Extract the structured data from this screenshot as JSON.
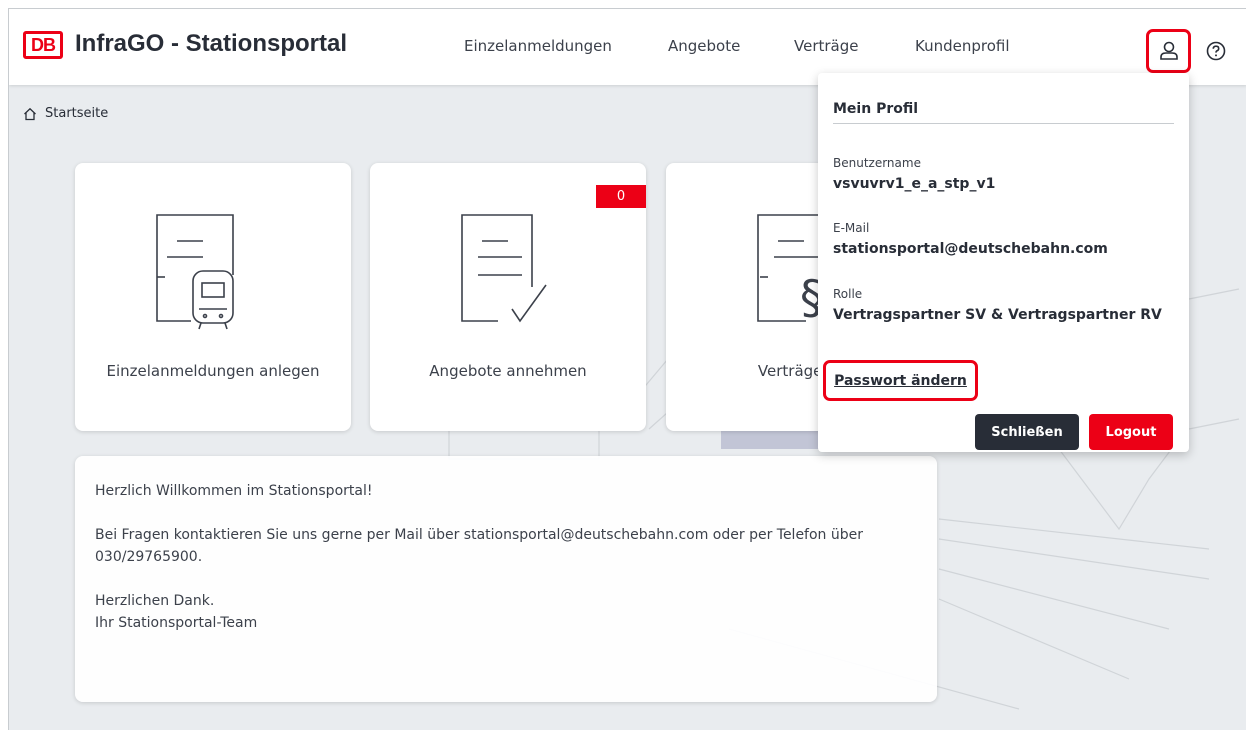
{
  "header": {
    "logo": "DB",
    "title": "InfraGO - Stationsportal",
    "nav": [
      "Einzelanmeldungen",
      "Angebote",
      "Verträge",
      "Kundenprofil"
    ],
    "icons": [
      "user-icon",
      "help-icon"
    ]
  },
  "breadcrumb": {
    "label": "Startseite"
  },
  "tiles": [
    {
      "label": "Einzelanmeldungen anlegen"
    },
    {
      "label": "Angebote annehmen",
      "badge": "0"
    },
    {
      "label": "Verträge ein"
    }
  ],
  "welcome": {
    "line1": "Herzlich Willkommen im Stationsportal!",
    "line2": "Bei Fragen kontaktieren Sie uns gerne per Mail über stationsportal@deutschebahn.com oder per Telefon über 030/29765900.",
    "line3a": "Herzlichen Dank.",
    "line3b": "Ihr Stationsportal-Team"
  },
  "profile": {
    "title": "Mein Profil",
    "username_label": "Benutzername",
    "username": "vsvuvrv1_e_a_stp_v1",
    "email_label": "E-Mail",
    "email": "stationsportal@deutschebahn.com",
    "role_label": "Rolle",
    "role": "Vertragspartner SV & Vertragspartner RV",
    "change_password": "Passwort ändern",
    "close_button": "Schließen",
    "logout_button": "Logout"
  },
  "colors": {
    "accent": "#ec0016",
    "dark": "#282d37",
    "background": "#e9ecef"
  }
}
